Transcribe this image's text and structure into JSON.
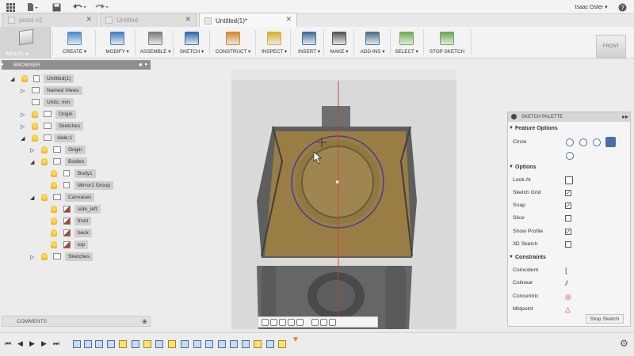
{
  "app": {
    "user": "Isaac Oster ▾",
    "tabs": [
      {
        "label": "pistol v2",
        "active": false
      },
      {
        "label": "Untitled",
        "active": false
      },
      {
        "label": "Untitled(1)*",
        "active": true
      }
    ]
  },
  "toolbar": {
    "workspace": "MODEL ▾",
    "tools": [
      {
        "label": "CREATE ▾",
        "icon": "box-icon",
        "color": "#4a8ad0"
      },
      {
        "label": "MODIFY ▾",
        "icon": "modify-icon",
        "color": "#3f7fc7"
      },
      {
        "label": "ASSEMBLE ▾",
        "icon": "assemble-icon",
        "color": "#7a7a7a"
      },
      {
        "label": "SKETCH ▾",
        "icon": "sketch-icon",
        "color": "#2b6bb0"
      },
      {
        "label": "CONSTRUCT ▾",
        "icon": "construct-icon",
        "color": "#d18a2c"
      },
      {
        "label": "INSPECT ▾",
        "icon": "measure-icon",
        "color": "#d6b22a"
      },
      {
        "label": "INSERT ▾",
        "icon": "image-icon",
        "color": "#3d6e9e"
      },
      {
        "label": "MAKE ▾",
        "icon": "print-icon",
        "color": "#555"
      },
      {
        "label": "ADD-INS ▾",
        "icon": "addins-icon",
        "color": "#4c6e8c"
      },
      {
        "label": "SELECT ▾",
        "icon": "select-icon",
        "color": "#6ab04c"
      },
      {
        "label": "STOP SKETCH",
        "icon": "stop-sketch-icon",
        "color": "#6aa84f"
      }
    ],
    "view_cube": "FRONT"
  },
  "browser": {
    "title": "BROWSER",
    "nodes": [
      {
        "label": "Untitled(1)",
        "icon": "file"
      },
      {
        "label": "Named Views",
        "icon": "folder"
      },
      {
        "label": "Units: mm",
        "icon": "doc"
      },
      {
        "label": "Origin",
        "icon": "folder"
      },
      {
        "label": "Sketches",
        "icon": "folder"
      },
      {
        "label": "slide:1",
        "icon": "component"
      },
      {
        "label": "Origin",
        "icon": "folder"
      },
      {
        "label": "Bodies",
        "icon": "folder"
      },
      {
        "label": "Body1",
        "icon": "body"
      },
      {
        "label": "Mirror1 Group",
        "icon": "body"
      },
      {
        "label": "Canvases",
        "icon": "folder"
      },
      {
        "label": "side_left",
        "icon": "canvas"
      },
      {
        "label": "front",
        "icon": "canvas"
      },
      {
        "label": "back",
        "icon": "canvas"
      },
      {
        "label": "top",
        "icon": "canvas"
      },
      {
        "label": "Sketches",
        "icon": "folder"
      }
    ],
    "comments": "COMMENTS"
  },
  "palette": {
    "title": "SKETCH PALETTE",
    "sections": {
      "feature": "Feature Options",
      "options": "Options",
      "constraints": "Constraints"
    },
    "circle_label": "Circle",
    "options": [
      {
        "label": "Look At",
        "kind": "icon"
      },
      {
        "label": "Sketch Grid",
        "kind": "check",
        "checked": true
      },
      {
        "label": "Snap",
        "kind": "check",
        "checked": true
      },
      {
        "label": "Slice",
        "kind": "check",
        "checked": false
      },
      {
        "label": "Show Profile",
        "kind": "check",
        "checked": true
      },
      {
        "label": "3D Sketch",
        "kind": "check",
        "checked": false
      }
    ],
    "constraints": [
      "Coincident",
      "Colinear",
      "Concentric",
      "Midpoint"
    ],
    "stop_button": "Stop Sketch"
  },
  "colors": {
    "sketch_circle": "#3a35a8",
    "axis_line": "#d23b3b",
    "part_tint": "#9a7a3e"
  }
}
